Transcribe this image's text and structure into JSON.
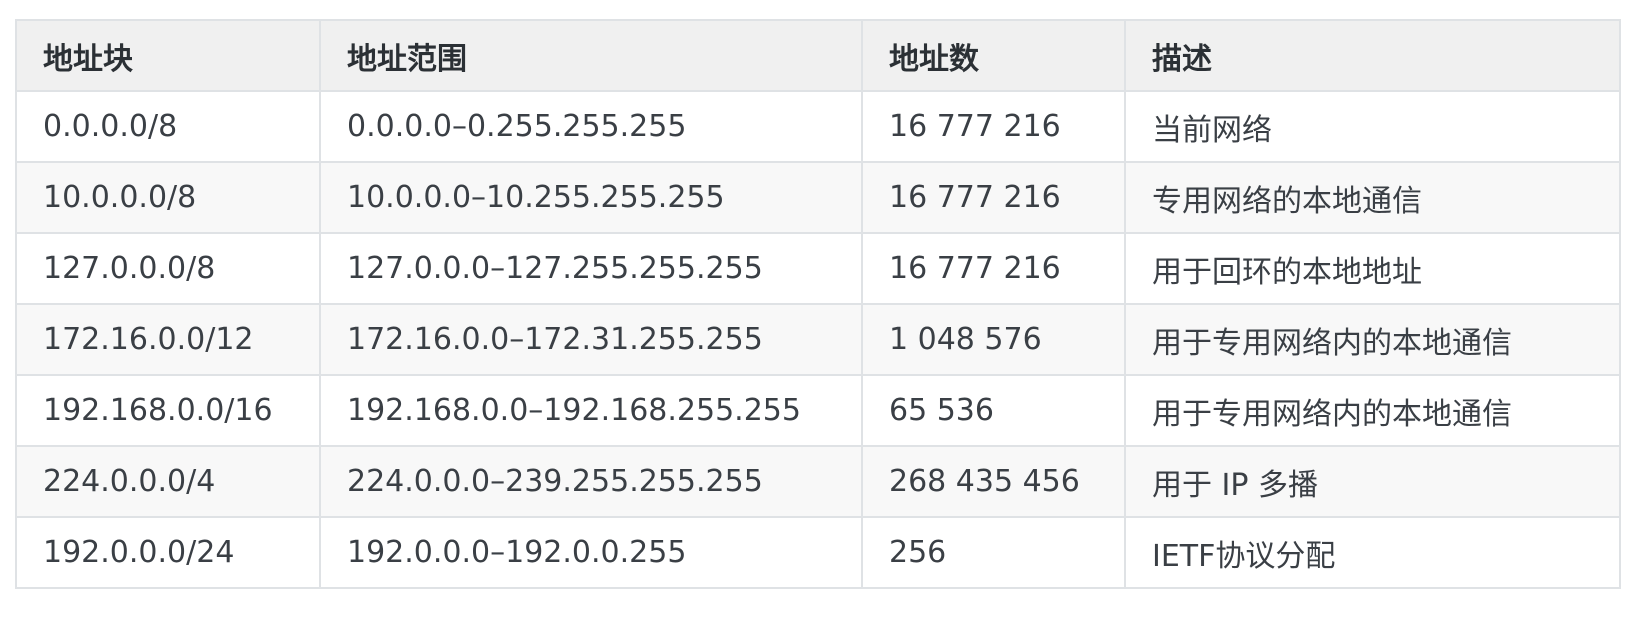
{
  "table": {
    "headers": [
      "地址块",
      "地址范围",
      "地址数",
      "描述"
    ],
    "rows": [
      [
        "0.0.0.0/8",
        "0.0.0.0–0.255.255.255",
        "16 777 216",
        "当前网络"
      ],
      [
        "10.0.0.0/8",
        "10.0.0.0–10.255.255.255",
        "16 777 216",
        "专用网络的本地通信"
      ],
      [
        "127.0.0.0/8",
        "127.0.0.0–127.255.255.255",
        "16 777 216",
        "用于回环的本地地址"
      ],
      [
        "172.16.0.0/12",
        "172.16.0.0–172.31.255.255",
        "1 048 576",
        "用于专用网络内的本地通信"
      ],
      [
        "192.168.0.0/16",
        "192.168.0.0–192.168.255.255",
        "65 536",
        "用于专用网络内的本地通信"
      ],
      [
        "224.0.0.0/4",
        "224.0.0.0–239.255.255.255",
        "268 435 456",
        "用于 IP 多播"
      ],
      [
        "192.0.0.0/24",
        "192.0.0.0–192.0.0.255",
        "256",
        "IETF协议分配"
      ]
    ]
  }
}
